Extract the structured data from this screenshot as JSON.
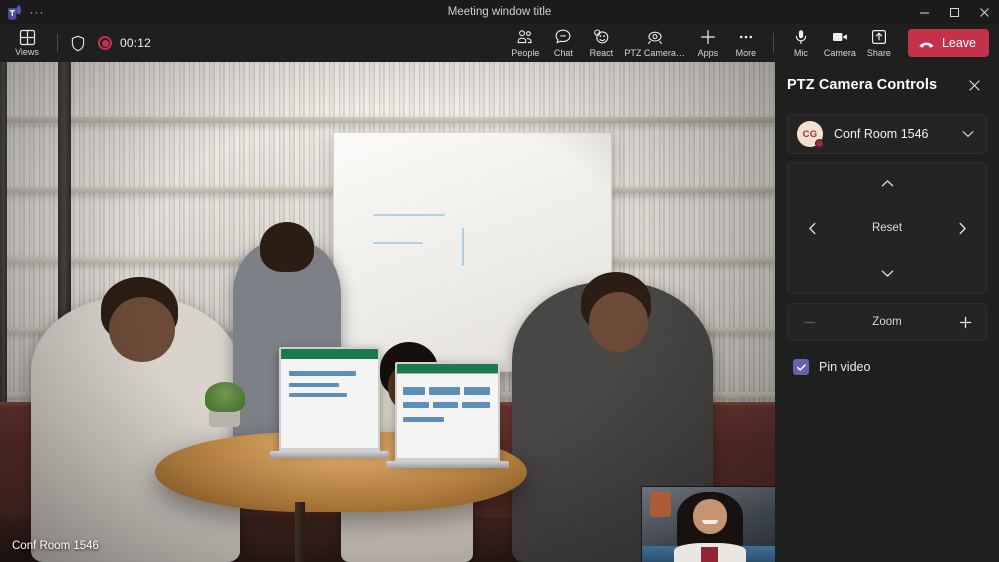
{
  "window": {
    "title": "Meeting window title",
    "logo_icon": "teams-logo-icon",
    "overflow_label": "···",
    "controls": {
      "minimize": "minimize-icon",
      "maximize": "maximize-icon",
      "close": "close-icon"
    }
  },
  "toolbar": {
    "views_label": "Views",
    "views_icon": "grid-icon",
    "shield_icon": "shield-icon",
    "record_icon": "record-dot-icon",
    "timer": "00:12",
    "items": [
      {
        "label": "People",
        "icon": "people-icon"
      },
      {
        "label": "Chat",
        "icon": "chat-icon"
      },
      {
        "label": "React",
        "icon": "react-icon"
      },
      {
        "label": "PTZ Camera…",
        "icon": "ptz-camera-icon"
      },
      {
        "label": "Apps",
        "icon": "plus-icon"
      },
      {
        "label": "More",
        "icon": "more-icon"
      }
    ],
    "media": [
      {
        "label": "Mic",
        "icon": "microphone-icon"
      },
      {
        "label": "Camera",
        "icon": "camera-icon"
      },
      {
        "label": "Share",
        "icon": "share-icon"
      }
    ],
    "leave_label": "Leave",
    "leave_icon": "hangup-icon",
    "leave_color": "#c4314b"
  },
  "video": {
    "label": "Conf Room 1546",
    "selfview_name": "self-view-video"
  },
  "panel": {
    "title": "PTZ Camera Controls",
    "close_icon": "close-icon",
    "device": {
      "initials": "CG",
      "name": "Conf Room 1546",
      "chevron_icon": "chevron-down-icon",
      "avatar_color": "#f3e0cf",
      "presence_color": "#a02a3c"
    },
    "dpad": {
      "up_icon": "chevron-up-icon",
      "down_icon": "chevron-down-icon",
      "left_icon": "chevron-left-icon",
      "right_icon": "chevron-right-icon",
      "reset_label": "Reset"
    },
    "zoom": {
      "label": "Zoom",
      "minus_icon": "minus-icon",
      "plus_icon": "plus-icon"
    },
    "pin": {
      "label": "Pin video",
      "checked": true,
      "accent_color": "#6264a7"
    }
  }
}
